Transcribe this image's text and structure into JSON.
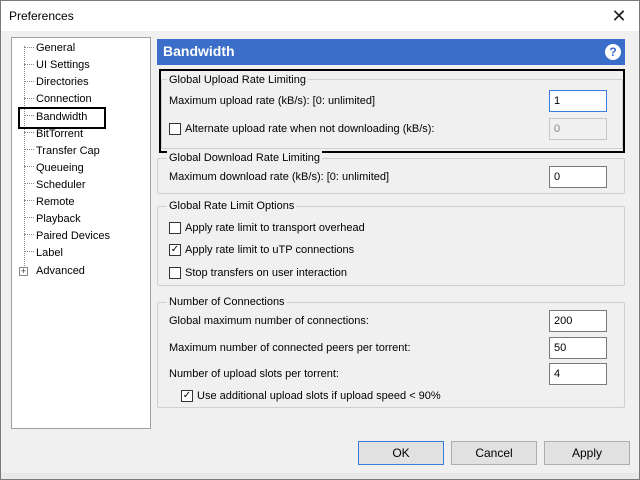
{
  "window": {
    "title": "Preferences",
    "close_glyph": "✕"
  },
  "tree": {
    "items": [
      "General",
      "UI Settings",
      "Directories",
      "Connection",
      "Bandwidth",
      "BitTorrent",
      "Transfer Cap",
      "Queueing",
      "Scheduler",
      "Remote",
      "Playback",
      "Paired Devices",
      "Label",
      "Advanced"
    ],
    "selected": "Bandwidth",
    "expander_glyph": "+"
  },
  "header": {
    "title": "Bandwidth",
    "help_glyph": "?"
  },
  "upload": {
    "title": "Global Upload Rate Limiting",
    "max_label": "Maximum upload rate (kB/s): [0: unlimited]",
    "max_value": "1",
    "alt_label": "Alternate upload rate when not downloading (kB/s):",
    "alt_value": "0",
    "alt_checked": false
  },
  "download": {
    "title": "Global Download Rate Limiting",
    "max_label": "Maximum download rate (kB/s): [0: unlimited]",
    "max_value": "0"
  },
  "options": {
    "title": "Global Rate Limit Options",
    "overhead_label": "Apply rate limit to transport overhead",
    "overhead_checked": false,
    "utp_label": "Apply rate limit to uTP connections",
    "utp_checked": true,
    "stop_label": "Stop transfers on user interaction",
    "stop_checked": false
  },
  "connections": {
    "title": "Number of Connections",
    "global_label": "Global maximum number of connections:",
    "global_value": "200",
    "peers_label": "Maximum number of connected peers per torrent:",
    "peers_value": "50",
    "slots_label": "Number of upload slots per torrent:",
    "slots_value": "4",
    "extra_label": "Use additional upload slots if upload speed < 90%",
    "extra_checked": true
  },
  "buttons": {
    "ok": "OK",
    "cancel": "Cancel",
    "apply": "Apply"
  },
  "check_glyph": "✓",
  "accent_color": "#3a6ec8"
}
